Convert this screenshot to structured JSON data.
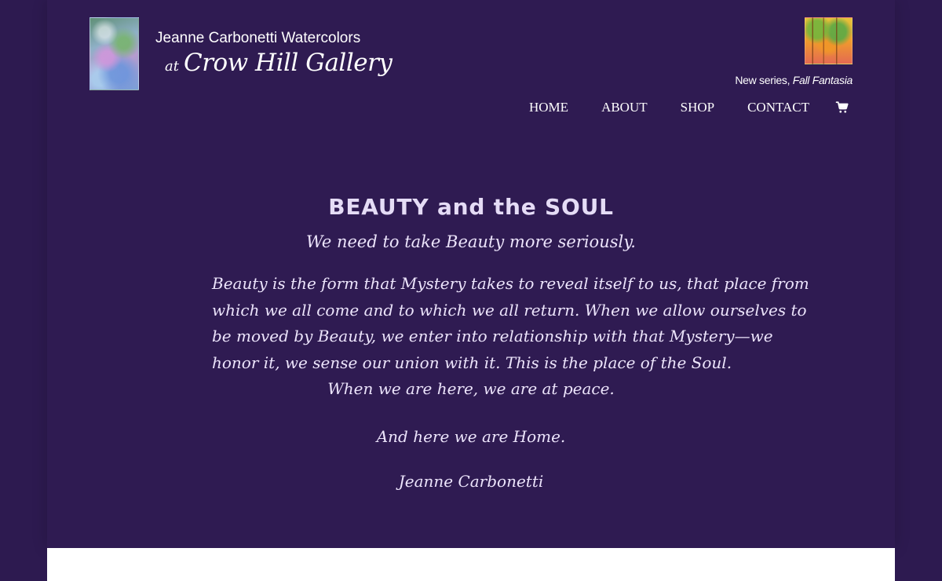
{
  "header": {
    "logo": {
      "line1": "Jeanne Carbonetti Watercolors",
      "line2_prefix": "at",
      "line2": "Crow Hill Gallery"
    },
    "promo": {
      "prefix": "New series, ",
      "title": "Fall Fantasia"
    },
    "nav": {
      "items": [
        {
          "label": "HOME"
        },
        {
          "label": "ABOUT"
        },
        {
          "label": "SHOP"
        },
        {
          "label": "CONTACT"
        }
      ],
      "cart_icon": "cart-icon"
    }
  },
  "main": {
    "title": "BEAUTY and the SOUL",
    "subtitle": "We need to take Beauty more seriously.",
    "paragraph_lines": [
      "Beauty is the form that Mystery takes to reveal itself to us, that place from",
      "which we all come and to which we all return. When we allow ourselves to",
      "be moved by Beauty, we enter into relationship with that Mystery—we",
      "honor it, we sense our union with it. This is the place of the Soul.",
      "When we are here, we are at peace."
    ],
    "closing": "And here we are Home.",
    "signature": "Jeanne Carbonetti"
  },
  "colors": {
    "background": "#2d1a50",
    "text": "#e7def7",
    "footer": "#ffffff"
  }
}
